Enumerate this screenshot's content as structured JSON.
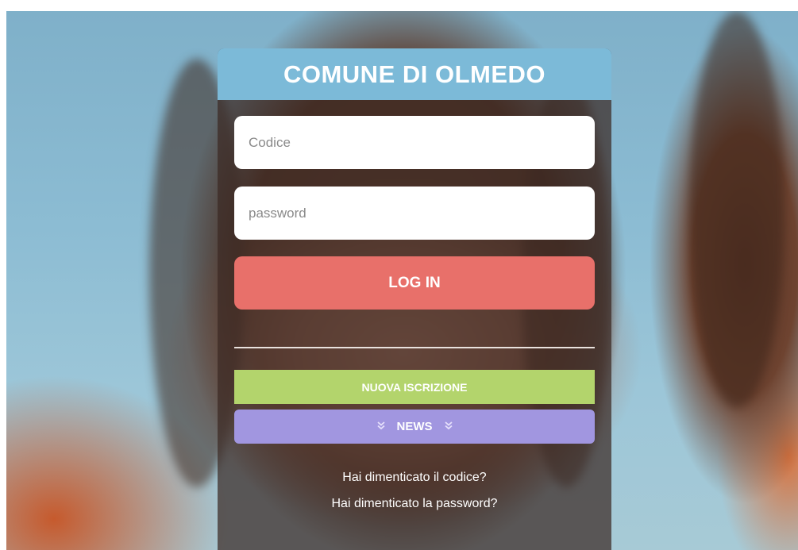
{
  "header": {
    "title": "COMUNE DI OLMEDO",
    "color": "#7cbad8"
  },
  "login_form": {
    "code_placeholder": "Codice",
    "code_value": "",
    "password_placeholder": "password",
    "password_value": "",
    "login_label": "LOG IN",
    "login_color": "#e8706a"
  },
  "actions": {
    "signup_label": "NUOVA ISCRIZIONE",
    "signup_color": "#b3d46c",
    "news_label": "NEWS",
    "news_icon": "double-chevron-down-icon",
    "news_color": "#a196e0"
  },
  "links": {
    "forgot_code": "Hai dimenticato il codice?",
    "forgot_password": "Hai dimenticato la password?"
  }
}
